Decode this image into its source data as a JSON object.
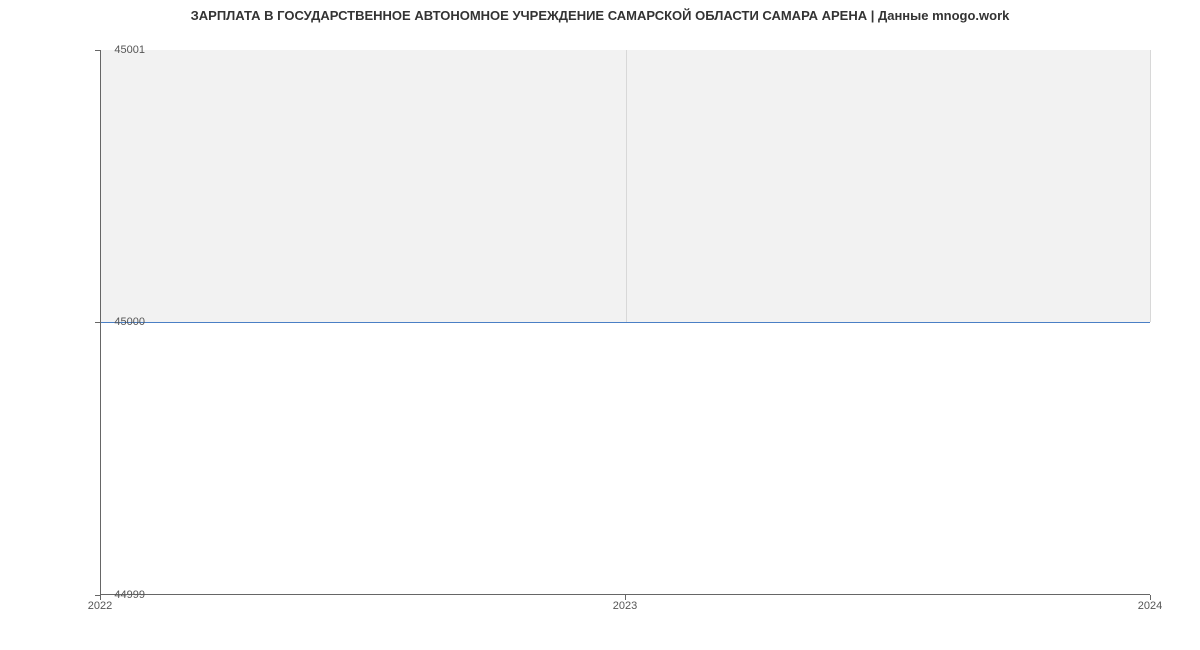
{
  "chart_data": {
    "type": "area",
    "title": "ЗАРПЛАТА В ГОСУДАРСТВЕННОЕ АВТОНОМНОЕ УЧРЕЖДЕНИЕ САМАРСКОЙ ОБЛАСТИ САМАРА АРЕНА | Данные mnogo.work",
    "x": [
      2022,
      2023,
      2024
    ],
    "values": [
      45000,
      45000,
      45000
    ],
    "xlabel": "",
    "ylabel": "",
    "xlim": [
      2022,
      2024
    ],
    "ylim": [
      44999,
      45001
    ],
    "x_ticks": [
      "2022",
      "2023",
      "2024"
    ],
    "y_ticks": [
      "44999",
      "45000",
      "45001"
    ],
    "line_color": "#4a7fc5",
    "fill_color": "#f2f2f2"
  }
}
